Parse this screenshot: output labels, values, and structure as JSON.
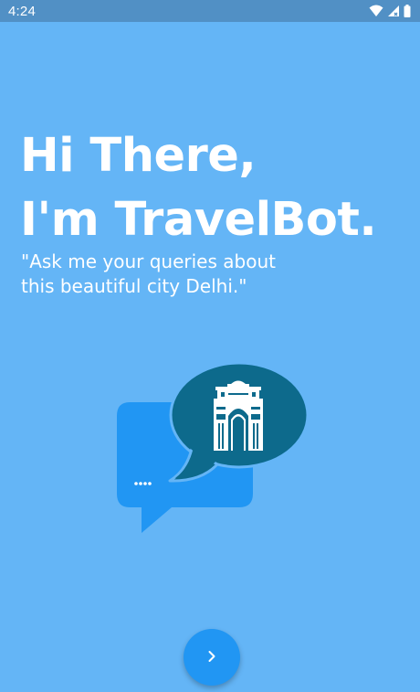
{
  "status_bar": {
    "time": "4:24",
    "icons": [
      "wifi-icon",
      "cell-signal-icon",
      "battery-icon"
    ]
  },
  "greeting": {
    "line1": "Hi There,",
    "line2": "I'm TravelBot."
  },
  "tagline": {
    "line1": "\"Ask me your queries about",
    "line2": "this beautiful city Delhi.\""
  },
  "illustration": {
    "icon": "chat-bubbles-india-gate-icon",
    "ellipsis": "...."
  },
  "next_button": {
    "icon": "chevron-right-icon"
  },
  "colors": {
    "background": "#64b5f6",
    "status_bar": "#5190c5",
    "accent": "#2196f3",
    "bubble_dark": "#0d6a8c",
    "text": "#ffffff"
  }
}
